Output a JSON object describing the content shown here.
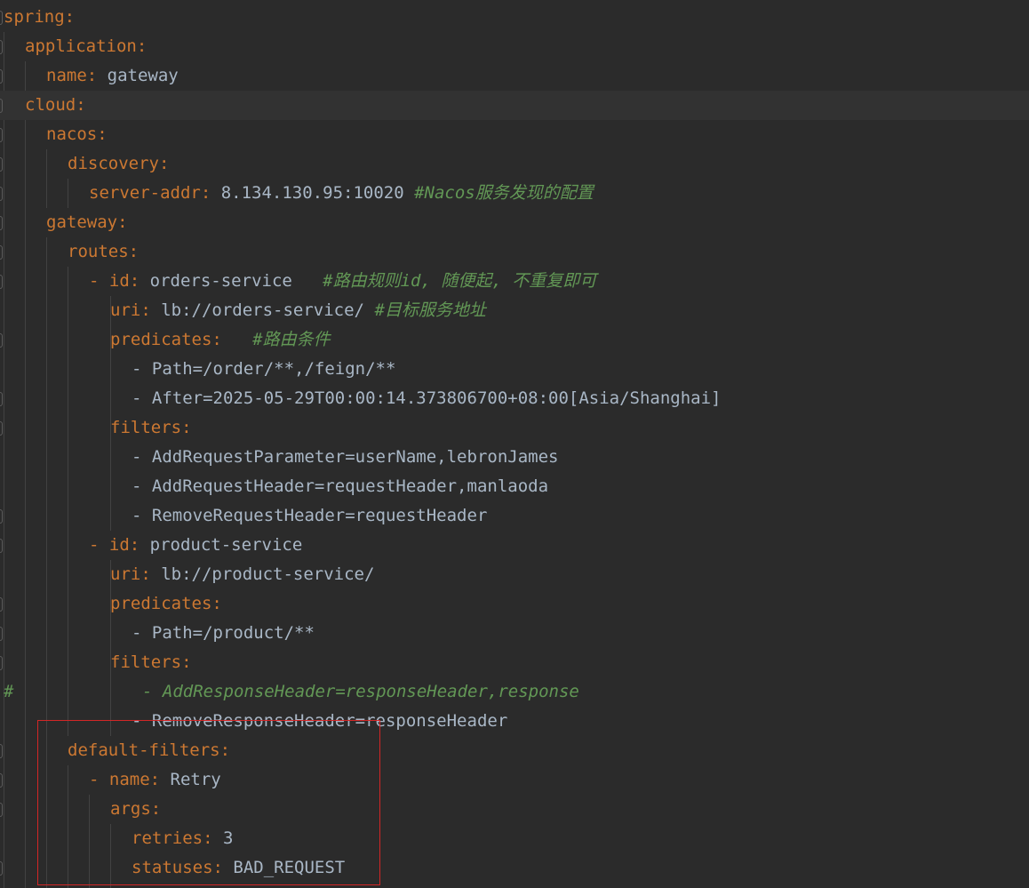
{
  "editor": {
    "colors": {
      "background": "#2b2b2b",
      "key": "#cc7832",
      "value": "#a9b7c6",
      "comment": "#629755",
      "highlight_box": "#d32626"
    },
    "lines": [
      {
        "key": "spring",
        "colon": ":"
      },
      {
        "key": "application",
        "colon": ":"
      },
      {
        "key": "name",
        "colon": ":",
        "value": " gateway"
      },
      {
        "key": "cloud",
        "colon": ":"
      },
      {
        "key": "nacos",
        "colon": ":"
      },
      {
        "key": "discovery",
        "colon": ":"
      },
      {
        "key": "server-addr",
        "colon": ":",
        "value": " 8.134.130.95:10020 ",
        "comment": "#Nacos服务发现的配置"
      },
      {
        "key": "gateway",
        "colon": ":"
      },
      {
        "key": "routes",
        "colon": ":"
      },
      {
        "dash": "- ",
        "key": "id",
        "colon": ":",
        "value": " orders-service   ",
        "comment": "#路由规则id, 随便起, 不重复即可"
      },
      {
        "key": "uri",
        "colon": ":",
        "value": " lb://orders-service/ ",
        "comment": "#目标服务地址"
      },
      {
        "key": "predicates",
        "colon": ":",
        "value": "   ",
        "comment": "#路由条件"
      },
      {
        "dash": "- ",
        "value": "Path=/order/**,/feign/**"
      },
      {
        "dash": "- ",
        "value": "After=2025-05-29T00:00:14.373806700+08:00[Asia/Shanghai]"
      },
      {
        "key": "filters",
        "colon": ":"
      },
      {
        "dash": "- ",
        "value": "AddRequestParameter=userName,lebronJames"
      },
      {
        "dash": "- ",
        "value": "AddRequestHeader=requestHeader,manlaoda"
      },
      {
        "dash": "- ",
        "value": "RemoveRequestHeader=requestHeader"
      },
      {
        "dash": "- ",
        "key": "id",
        "colon": ":",
        "value": " product-service"
      },
      {
        "key": "uri",
        "colon": ":",
        "value": " lb://product-service/"
      },
      {
        "key": "predicates",
        "colon": ":"
      },
      {
        "dash": "- ",
        "value": "Path=/product/**"
      },
      {
        "key": "filters",
        "colon": ":"
      },
      {
        "hash": "#",
        "commented": "- AddResponseHeader=responseHeader,response"
      },
      {
        "dash": "- ",
        "value": "RemoveResponseHeader=responseHeader"
      },
      {
        "key": "default-filters",
        "colon": ":"
      },
      {
        "dash": "- ",
        "key": "name",
        "colon": ":",
        "value": " Retry"
      },
      {
        "key": "args",
        "colon": ":"
      },
      {
        "key": "retries",
        "colon": ":",
        "value": " 3"
      },
      {
        "key": "statuses",
        "colon": ":",
        "value": " BAD_REQUEST"
      }
    ]
  }
}
